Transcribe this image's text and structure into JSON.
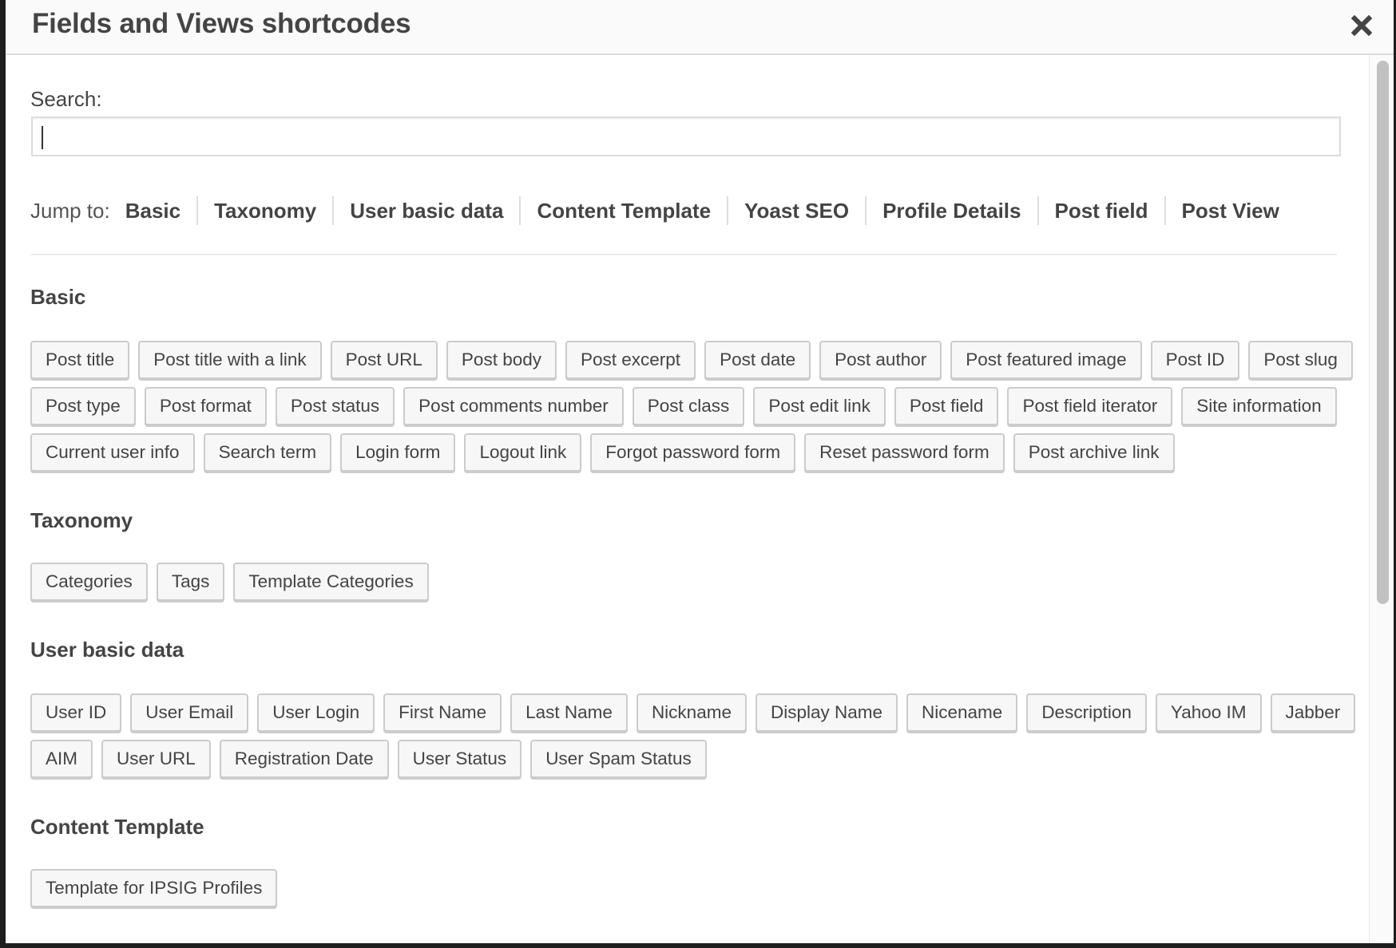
{
  "dialog": {
    "title": "Fields and Views shortcodes",
    "close_icon": "close-x-icon"
  },
  "search": {
    "label": "Search:",
    "value": "",
    "placeholder": ""
  },
  "jump": {
    "label": "Jump to:",
    "links": [
      "Basic",
      "Taxonomy",
      "User basic data",
      "Content Template",
      "Yoast SEO",
      "Profile Details",
      "Post field",
      "Post View"
    ]
  },
  "sections": [
    {
      "title": "Basic",
      "buttons": [
        "Post title",
        "Post title with a link",
        "Post URL",
        "Post body",
        "Post excerpt",
        "Post date",
        "Post author",
        "Post featured image",
        "Post ID",
        "Post slug",
        "Post type",
        "Post format",
        "Post status",
        "Post comments number",
        "Post class",
        "Post edit link",
        "Post field",
        "Post field iterator",
        "Site information",
        "Current user info",
        "Search term",
        "Login form",
        "Logout link",
        "Forgot password form",
        "Reset password form",
        "Post archive link"
      ]
    },
    {
      "title": "Taxonomy",
      "buttons": [
        "Categories",
        "Tags",
        "Template Categories"
      ]
    },
    {
      "title": "User basic data",
      "buttons": [
        "User ID",
        "User Email",
        "User Login",
        "First Name",
        "Last Name",
        "Nickname",
        "Display Name",
        "Nicename",
        "Description",
        "Yahoo IM",
        "Jabber",
        "AIM",
        "User URL",
        "Registration Date",
        "User Status",
        "User Spam Status"
      ]
    },
    {
      "title": "Content Template",
      "buttons": [
        "Template for IPSIG Profiles"
      ]
    }
  ],
  "colors": {
    "text": "#444444",
    "button_bg": "#f7f7f7",
    "button_border": "#cccccc",
    "header_bg": "#fafafa"
  }
}
